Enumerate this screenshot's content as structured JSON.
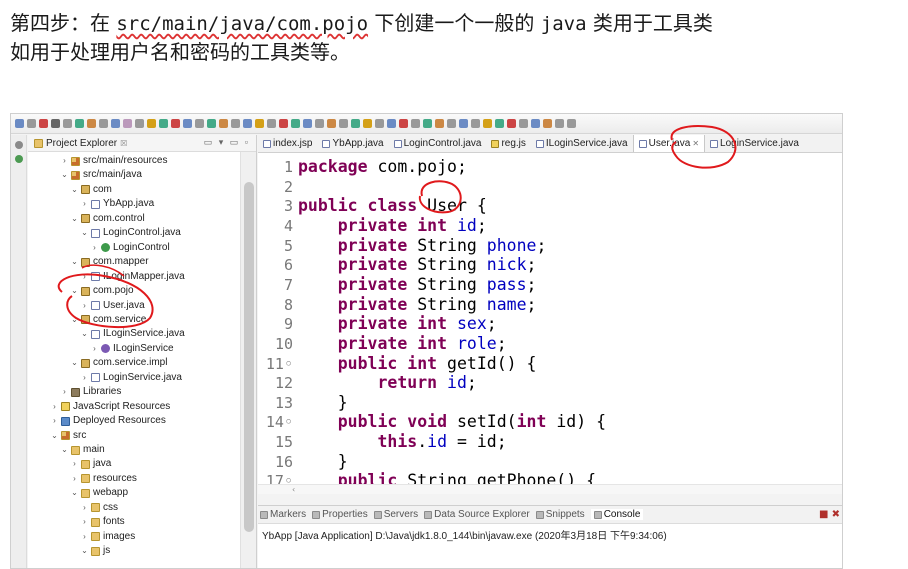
{
  "doc": {
    "line1_prefix": "第四步：在 ",
    "line1_path": "src/main/java/com.pojo",
    "line1_middle": " 下创建一个一般的 ",
    "line1_java": "java",
    "line1_suffix": " 类用于工具类",
    "line2": "如用于处理用户名和密码的工具类等。"
  },
  "explorer": {
    "tab_label": "Project Explorer",
    "tab_close": "☒",
    "items": [
      {
        "label": "src/main/resources",
        "twisty": "›"
      },
      {
        "label": "src/main/java",
        "twisty": "⌄"
      },
      {
        "label": "com",
        "twisty": "⌄"
      },
      {
        "label": "YbApp.java",
        "twisty": "›"
      },
      {
        "label": "com.control",
        "twisty": "⌄"
      },
      {
        "label": "LoginControl.java",
        "twisty": "⌄"
      },
      {
        "label": "LoginControl",
        "twisty": "›"
      },
      {
        "label": "com.mapper",
        "twisty": "⌄"
      },
      {
        "label": "ILoginMapper.java",
        "twisty": "›"
      },
      {
        "label": "com.pojo",
        "twisty": "⌄"
      },
      {
        "label": "User.java",
        "twisty": "›"
      },
      {
        "label": "com.service",
        "twisty": "⌄"
      },
      {
        "label": "ILoginService.java",
        "twisty": "⌄"
      },
      {
        "label": "ILoginService",
        "twisty": "›"
      },
      {
        "label": "com.service.impl",
        "twisty": "⌄"
      },
      {
        "label": "LoginService.java",
        "twisty": "›"
      },
      {
        "label": "Libraries",
        "twisty": "›"
      },
      {
        "label": "JavaScript Resources",
        "twisty": "›"
      },
      {
        "label": "Deployed Resources",
        "twisty": "›"
      },
      {
        "label": "src",
        "twisty": "⌄"
      },
      {
        "label": "main",
        "twisty": "⌄"
      },
      {
        "label": "java",
        "twisty": "›"
      },
      {
        "label": "resources",
        "twisty": "›"
      },
      {
        "label": "webapp",
        "twisty": "⌄"
      },
      {
        "label": "css",
        "twisty": "›"
      },
      {
        "label": "fonts",
        "twisty": "›"
      },
      {
        "label": "images",
        "twisty": "›"
      },
      {
        "label": "js",
        "twisty": "⌄"
      }
    ]
  },
  "editor": {
    "tabs": [
      {
        "label": "index.jsp"
      },
      {
        "label": "YbApp.java"
      },
      {
        "label": "LoginControl.java"
      },
      {
        "label": "reg.js"
      },
      {
        "label": "ILoginService.java"
      },
      {
        "label": "User.java",
        "close": "✕"
      },
      {
        "label": "LoginService.java"
      }
    ],
    "lines": [
      {
        "n": "1",
        "t": [
          [
            "kw",
            "package"
          ],
          [
            "c",
            " com.pojo;"
          ]
        ]
      },
      {
        "n": "2",
        "t": []
      },
      {
        "n": "3",
        "t": [
          [
            "kw",
            "public"
          ],
          [
            "c",
            " "
          ],
          [
            "kw",
            "class"
          ],
          [
            "c",
            " User {"
          ]
        ]
      },
      {
        "n": "4",
        "t": [
          [
            "c",
            "    "
          ],
          [
            "kw",
            "private"
          ],
          [
            "c",
            " "
          ],
          [
            "kw",
            "int"
          ],
          [
            "c",
            " "
          ],
          [
            "f",
            "id"
          ],
          [
            "c",
            ";"
          ]
        ]
      },
      {
        "n": "5",
        "t": [
          [
            "c",
            "    "
          ],
          [
            "kw",
            "private"
          ],
          [
            "c",
            " String "
          ],
          [
            "f",
            "phone"
          ],
          [
            "c",
            ";"
          ]
        ]
      },
      {
        "n": "6",
        "t": [
          [
            "c",
            "    "
          ],
          [
            "kw",
            "private"
          ],
          [
            "c",
            " String "
          ],
          [
            "f",
            "nick"
          ],
          [
            "c",
            ";"
          ]
        ]
      },
      {
        "n": "7",
        "t": [
          [
            "c",
            "    "
          ],
          [
            "kw",
            "private"
          ],
          [
            "c",
            " String "
          ],
          [
            "f",
            "pass"
          ],
          [
            "c",
            ";"
          ]
        ]
      },
      {
        "n": "8",
        "t": [
          [
            "c",
            "    "
          ],
          [
            "kw",
            "private"
          ],
          [
            "c",
            " String "
          ],
          [
            "f",
            "name"
          ],
          [
            "c",
            ";"
          ]
        ]
      },
      {
        "n": "9",
        "t": [
          [
            "c",
            "    "
          ],
          [
            "kw",
            "private"
          ],
          [
            "c",
            " "
          ],
          [
            "kw",
            "int"
          ],
          [
            "c",
            " "
          ],
          [
            "f",
            "sex"
          ],
          [
            "c",
            ";"
          ]
        ]
      },
      {
        "n": "10",
        "t": [
          [
            "c",
            "    "
          ],
          [
            "kw",
            "private"
          ],
          [
            "c",
            " "
          ],
          [
            "kw",
            "int"
          ],
          [
            "c",
            " "
          ],
          [
            "f",
            "role"
          ],
          [
            "c",
            ";"
          ]
        ]
      },
      {
        "n": "11◦",
        "t": [
          [
            "c",
            "    "
          ],
          [
            "kw",
            "public"
          ],
          [
            "c",
            " "
          ],
          [
            "kw",
            "int"
          ],
          [
            "c",
            " getId() {"
          ]
        ]
      },
      {
        "n": "12",
        "t": [
          [
            "c",
            "        "
          ],
          [
            "kw",
            "return"
          ],
          [
            "c",
            " "
          ],
          [
            "f",
            "id"
          ],
          [
            "c",
            ";"
          ]
        ]
      },
      {
        "n": "13",
        "t": [
          [
            "c",
            "    }"
          ]
        ]
      },
      {
        "n": "14◦",
        "t": [
          [
            "c",
            "    "
          ],
          [
            "kw",
            "public"
          ],
          [
            "c",
            " "
          ],
          [
            "kw",
            "void"
          ],
          [
            "c",
            " setId("
          ],
          [
            "kw",
            "int"
          ],
          [
            "c",
            " id) {"
          ]
        ]
      },
      {
        "n": "15",
        "t": [
          [
            "c",
            "        "
          ],
          [
            "kw",
            "this"
          ],
          [
            "c",
            "."
          ],
          [
            "f",
            "id"
          ],
          [
            "c",
            " = id;"
          ]
        ]
      },
      {
        "n": "16",
        "t": [
          [
            "c",
            "    }"
          ]
        ]
      },
      {
        "n": "17◦",
        "t": [
          [
            "c",
            "    "
          ],
          [
            "kw",
            "public"
          ],
          [
            "c",
            " String getPhone() {"
          ]
        ]
      }
    ],
    "hscroll_arrow": "‹"
  },
  "console": {
    "tabs": [
      {
        "label": "Markers"
      },
      {
        "label": "Properties"
      },
      {
        "label": "Servers"
      },
      {
        "label": "Data Source Explorer"
      },
      {
        "label": "Snippets"
      },
      {
        "label": "Console",
        "active": true
      }
    ],
    "controls": "■ ✖",
    "status": "YbApp [Java Application] D:\\Java\\jdk1.8.0_144\\bin\\javaw.exe (2020年3月18日 下午9:34:06)"
  },
  "colors": {
    "keyword": "#7f0055",
    "field": "#0000c0",
    "annotation_red": "#e0191c"
  }
}
